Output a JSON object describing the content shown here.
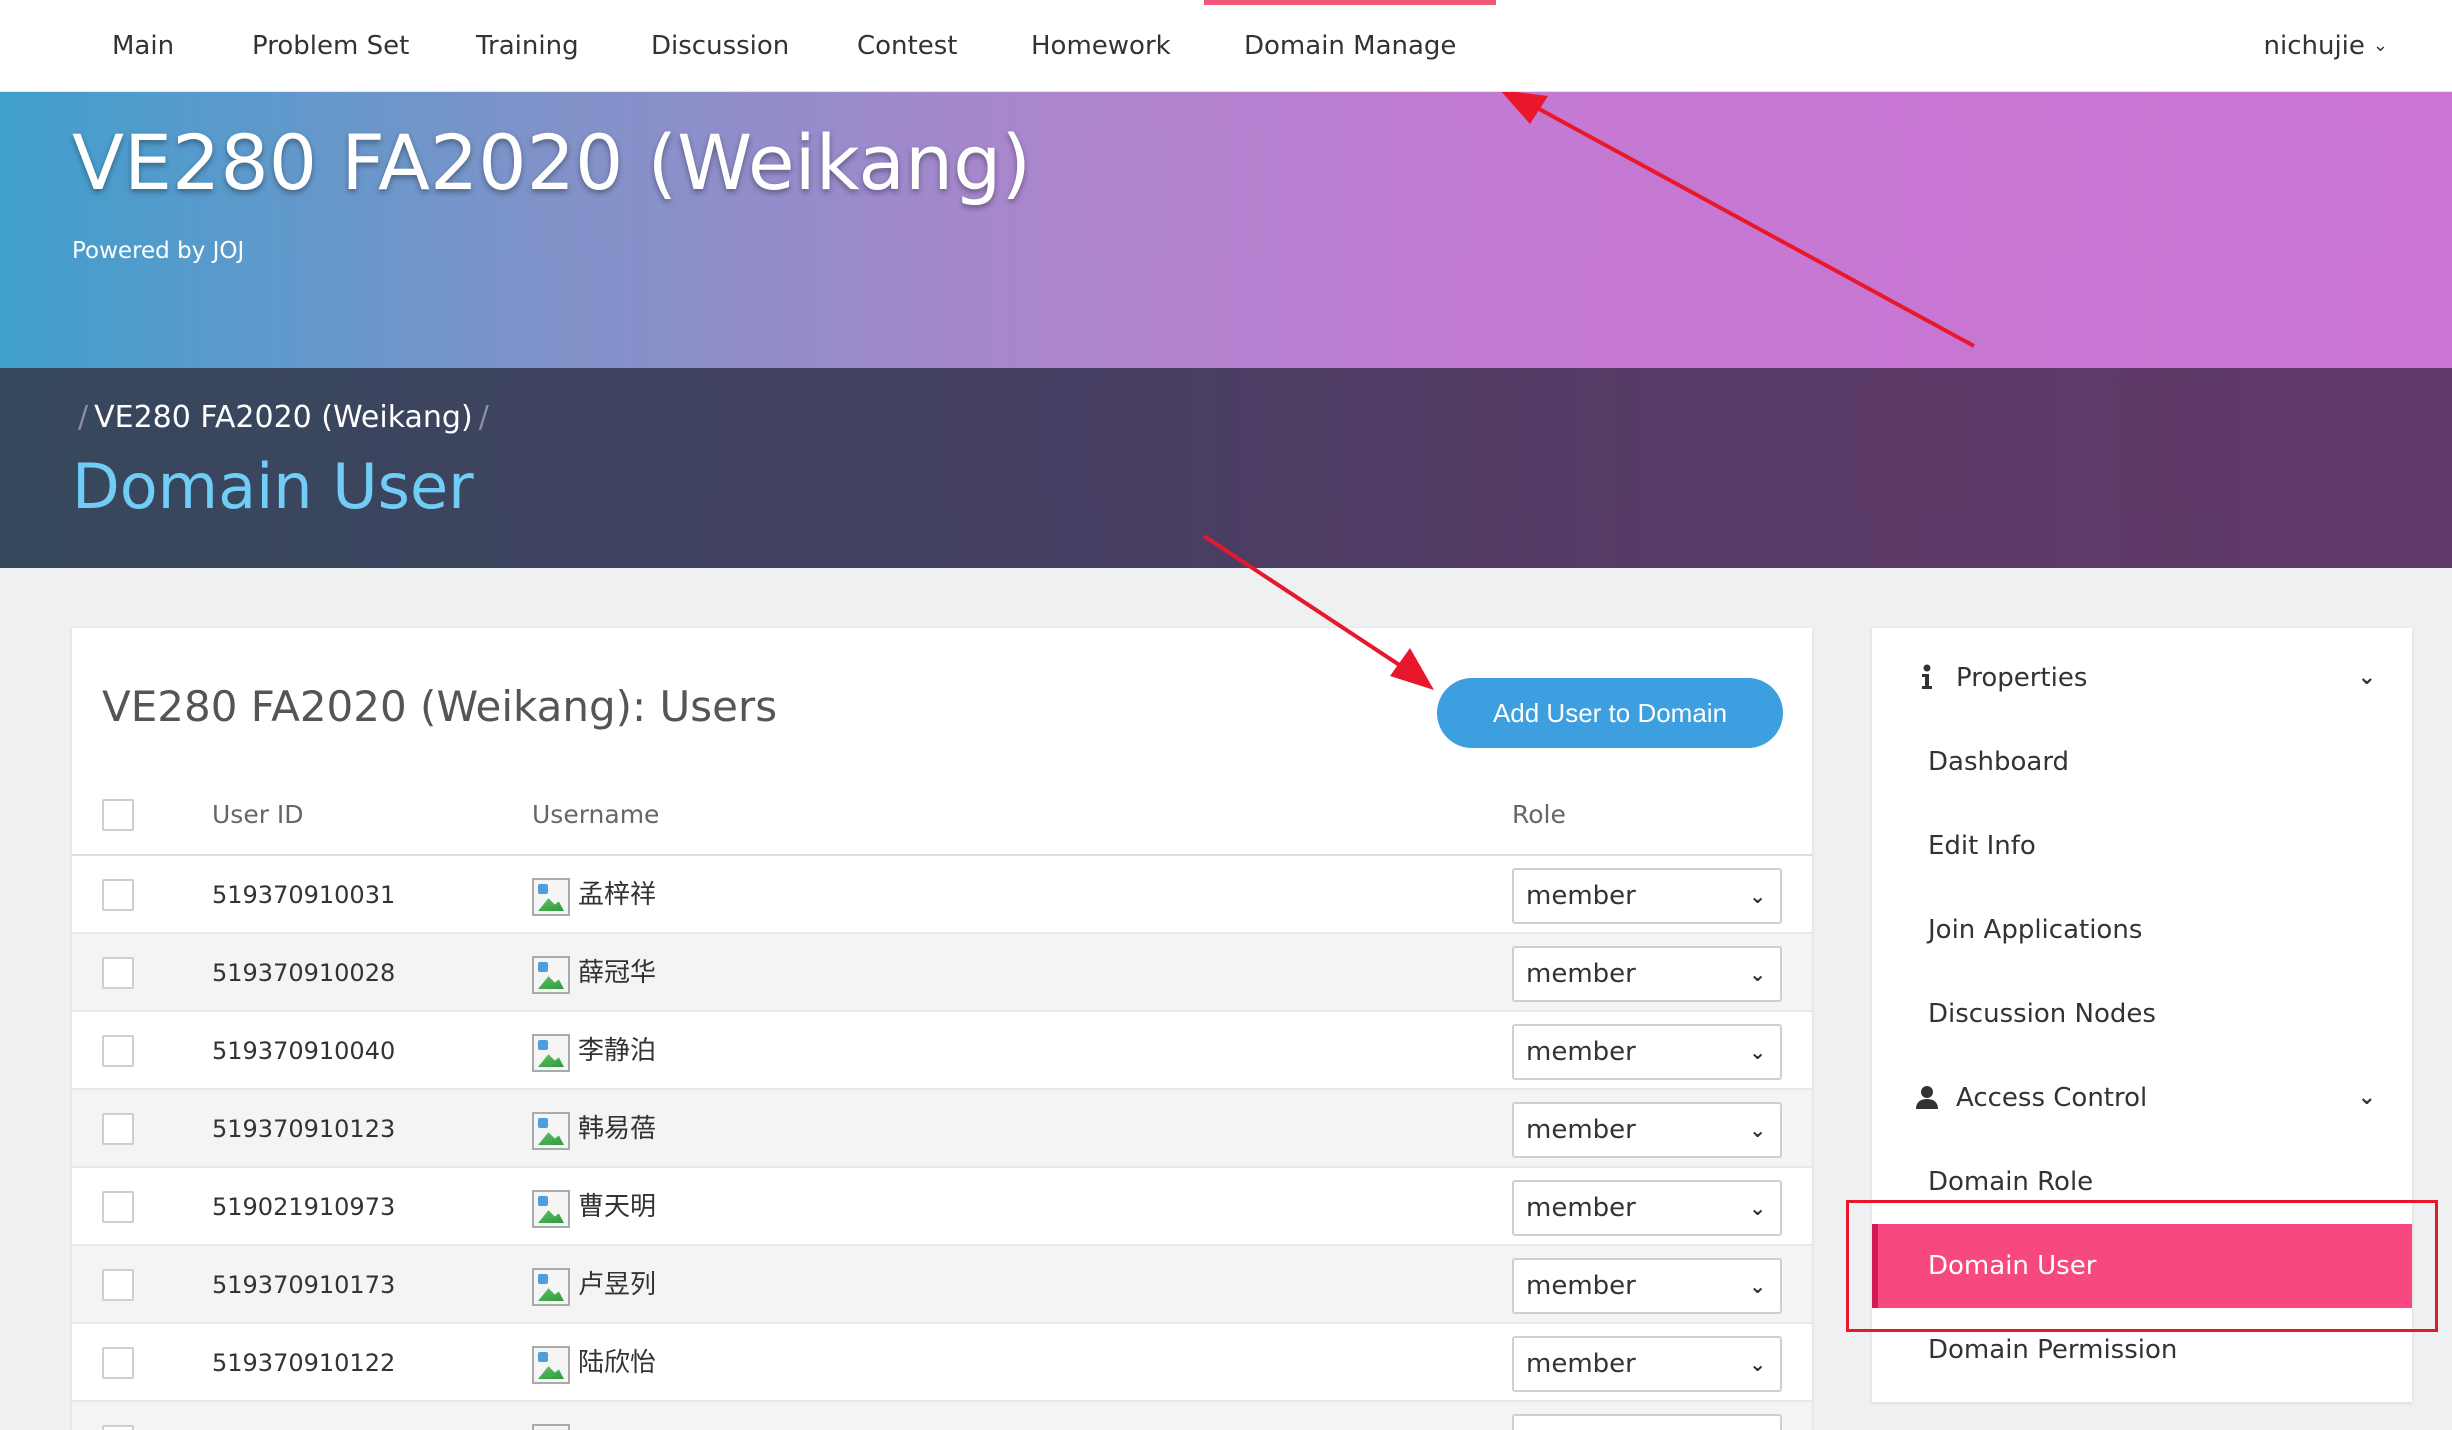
{
  "nav": {
    "items": [
      "Main",
      "Problem Set",
      "Training",
      "Discussion",
      "Contest",
      "Homework",
      "Domain Manage"
    ],
    "active_index": 6,
    "user": "nichujie"
  },
  "hero": {
    "title": "VE280 FA2020 (Weikang)",
    "subtitle": "Powered by JOJ"
  },
  "banner": {
    "breadcrumb": "VE280 FA2020 (Weikang)",
    "heading": "Domain User"
  },
  "users_card": {
    "title": "VE280 FA2020 (Weikang): Users",
    "add_button": "Add User to Domain",
    "columns": [
      "User ID",
      "Username",
      "Role"
    ],
    "rows": [
      {
        "id": "519370910031",
        "name": "孟梓祥",
        "role": "member"
      },
      {
        "id": "519370910028",
        "name": "薛冠华",
        "role": "member"
      },
      {
        "id": "519370910040",
        "name": "李静泊",
        "role": "member"
      },
      {
        "id": "519370910123",
        "name": "韩易蓓",
        "role": "member"
      },
      {
        "id": "519021910973",
        "name": "曹天明",
        "role": "member"
      },
      {
        "id": "519370910173",
        "name": "卢昱列",
        "role": "member"
      },
      {
        "id": "519370910122",
        "name": "陆欣怡",
        "role": "member"
      },
      {
        "id": "",
        "name": "",
        "role": ""
      }
    ]
  },
  "sidebar": {
    "sections": [
      {
        "label": "Properties",
        "icon": "info-icon",
        "items": [
          "Dashboard",
          "Edit Info",
          "Join Applications",
          "Discussion Nodes"
        ]
      },
      {
        "label": "Access Control",
        "icon": "user-icon",
        "items": [
          "Domain Role",
          "Domain User",
          "Domain Permission"
        ]
      }
    ],
    "active_item": "Domain User"
  },
  "colors": {
    "accent_pink": "#f7497f",
    "button_blue": "#3d9ee0",
    "heading_blue": "#6fcdf6",
    "annotation_red": "#e8172b"
  }
}
